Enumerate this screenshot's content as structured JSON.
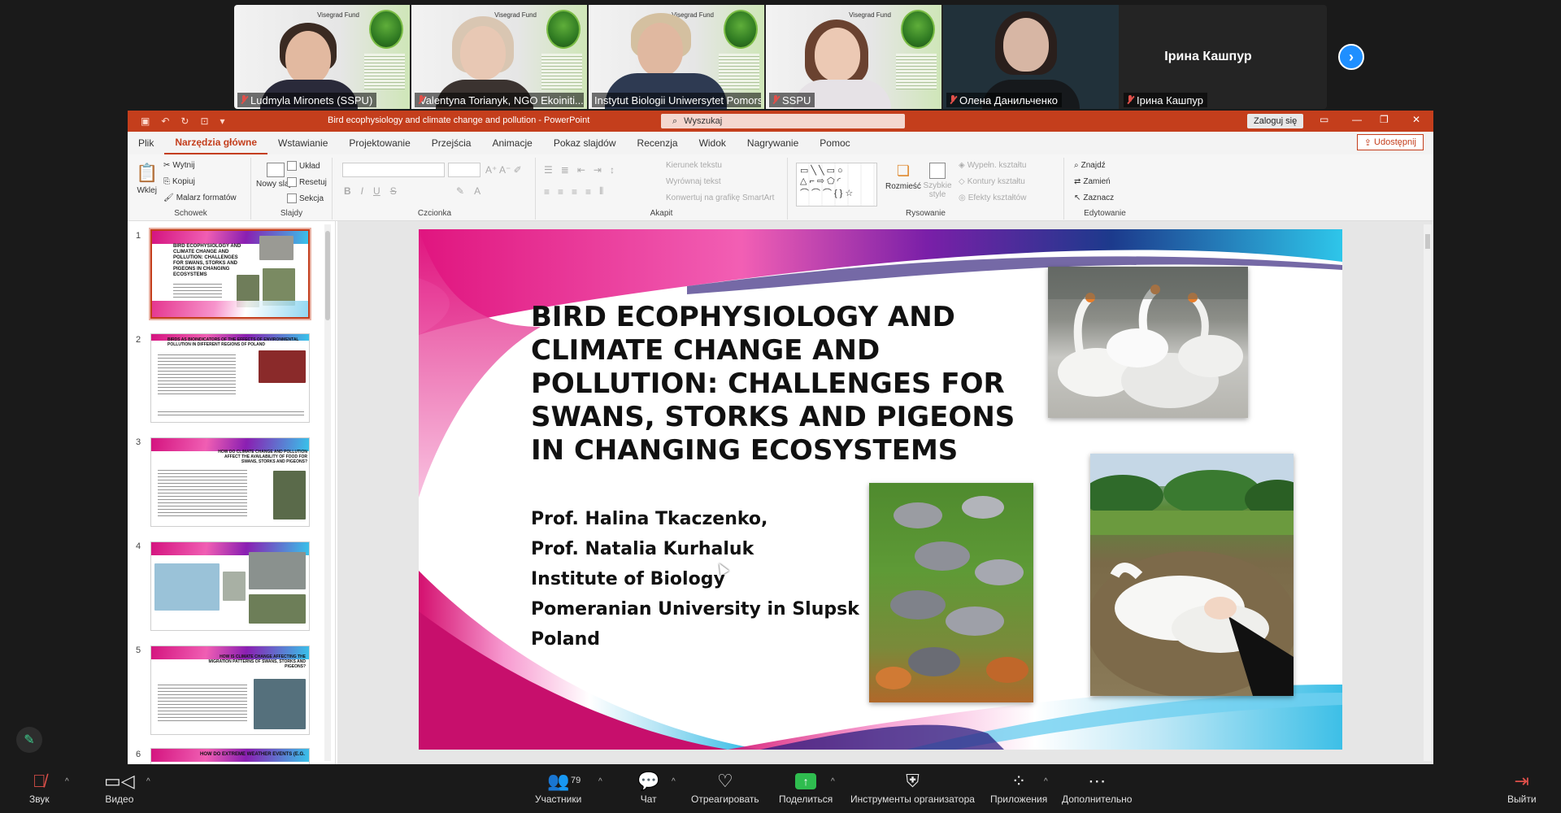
{
  "gallery": {
    "participants": [
      {
        "name": "Ludmyla Mironets (SSPU)",
        "muted": true,
        "active": false
      },
      {
        "name": "Valentyna Torianyk, NGO Ekoiniti...",
        "muted": true,
        "active": false
      },
      {
        "name": "Instytut Biologii Uniwersytet Pomors...",
        "muted": false,
        "active": true
      },
      {
        "name": "SSPU",
        "muted": true,
        "active": false
      },
      {
        "name": "Олена Данильченко",
        "muted": true,
        "active": false
      },
      {
        "name": "Ірина Кашпур",
        "muted": true,
        "active": false
      }
    ],
    "tile_center_name": "Ірина Кашпур",
    "poster_fund": "Visegrad Fund"
  },
  "ppt": {
    "window_title": "Bird ecophysiology and climate change and pollution  -  PowerPoint",
    "search_placeholder": "Wyszukaj",
    "login_label": "Zaloguj się",
    "share_label": "Udostępnij",
    "tabs": [
      "Plik",
      "Narzędzia główne",
      "Wstawianie",
      "Projektowanie",
      "Przejścia",
      "Animacje",
      "Pokaz slajdów",
      "Recenzja",
      "Widok",
      "Nagrywanie",
      "Pomoc"
    ],
    "ribbon": {
      "clipboard": {
        "paste": "Wklej",
        "cut": "Wytnij",
        "copy": "Kopiuj",
        "painter": "Malarz formatów",
        "label": "Schowek"
      },
      "slides": {
        "new": "Nowy slajd",
        "layout": "Układ",
        "reset": "Resetuj",
        "section": "Sekcja",
        "label": "Slajdy"
      },
      "font": {
        "label": "Czcionka"
      },
      "paragraph": {
        "direction": "Kierunek tekstu",
        "align": "Wyrównaj tekst",
        "smartart": "Konwertuj na grafikę SmartArt",
        "label": "Akapit"
      },
      "drawing": {
        "arrange": "Rozmieść",
        "quick_styles": "Szybkie style",
        "fill": "Wypełn. kształtu",
        "outline": "Kontury kształtu",
        "effects": "Efekty kształtów",
        "label": "Rysowanie"
      },
      "editing": {
        "find": "Znajdź",
        "replace": "Zamień",
        "select": "Zaznacz",
        "label": "Edytowanie"
      }
    },
    "thumbnails": [
      {
        "num": "1",
        "title": "BIRD ECOPHYSIOLOGY AND CLIMATE CHANGE AND POLLUTION: CHALLENGES FOR SWANS, STORKS AND PIGEONS IN CHANGING ECOSYSTEMS"
      },
      {
        "num": "2",
        "title": "BIRDS AS BIOINDICATORS OF THE EFFECTS OF ENVIRONMENTAL POLLUTION IN DIFFERENT REGIONS OF POLAND"
      },
      {
        "num": "3",
        "title": "HOW DO CLIMATE CHANGE AND POLLUTION AFFECT THE AVAILABILITY OF FOOD FOR SWANS, STORKS AND PIGEONS?"
      },
      {
        "num": "4",
        "title": ""
      },
      {
        "num": "5",
        "title": "HOW IS CLIMATE CHANGE AFFECTING THE MIGRATION PATTERNS OF SWANS, STORKS AND PIGEONS?"
      },
      {
        "num": "6",
        "title": "HOW DO EXTREME WEATHER EVENTS (E.G."
      }
    ],
    "slide": {
      "title": "Bird ecophysiology and climate change and pollution: challenges for swans, storks and pigeons in changing ecosystems",
      "authors": [
        "Prof. Halina Tkaczenko,",
        "Prof. Natalia Kurhaluk",
        "Institute of Biology",
        "Pomeranian University in Slupsk",
        "Poland"
      ]
    }
  },
  "toolbar": {
    "audio": "Звук",
    "video": "Видео",
    "participants": "Участники",
    "participants_count": "79",
    "chat": "Чат",
    "react": "Отреагировать",
    "share": "Поделиться",
    "host_tools": "Инструменты организатора",
    "apps": "Приложения",
    "more": "Дополнительно",
    "leave": "Выйти"
  }
}
